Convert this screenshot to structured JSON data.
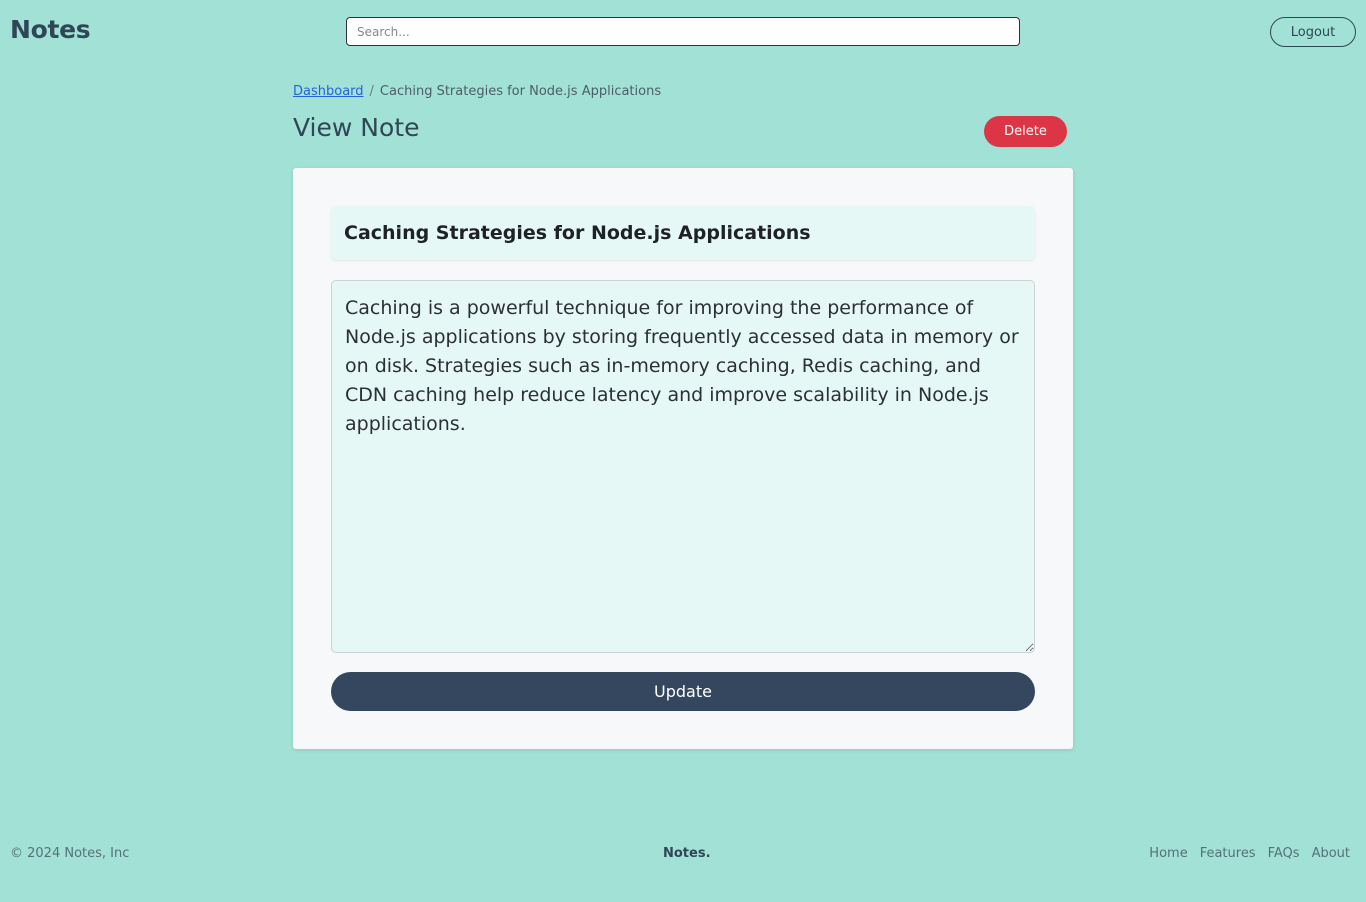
{
  "header": {
    "logo": "Notes",
    "search_placeholder": "Search...",
    "logout_label": "Logout"
  },
  "breadcrumb": {
    "dashboard": "Dashboard",
    "separator": "/",
    "current": "Caching Strategies for Node.js Applications"
  },
  "page": {
    "title": "View Note",
    "delete_label": "Delete"
  },
  "note": {
    "title": "Caching Strategies for Node.js Applications",
    "body": "Caching is a powerful technique for improving the performance of Node.js applications by storing frequently accessed data in memory or on disk. Strategies such as in-memory caching, Redis caching, and CDN caching help reduce latency and improve scalability in Node.js applications.",
    "update_label": "Update"
  },
  "footer": {
    "copyright": "© 2024 Notes, Inc",
    "brand": "Notes.",
    "links": [
      "Home",
      "Features",
      "FAQs",
      "About"
    ]
  },
  "colors": {
    "background": "#a2e2d6",
    "card": "#f6f8f9",
    "delete": "#dc3545",
    "update": "#34475e",
    "link": "#2563d9"
  }
}
